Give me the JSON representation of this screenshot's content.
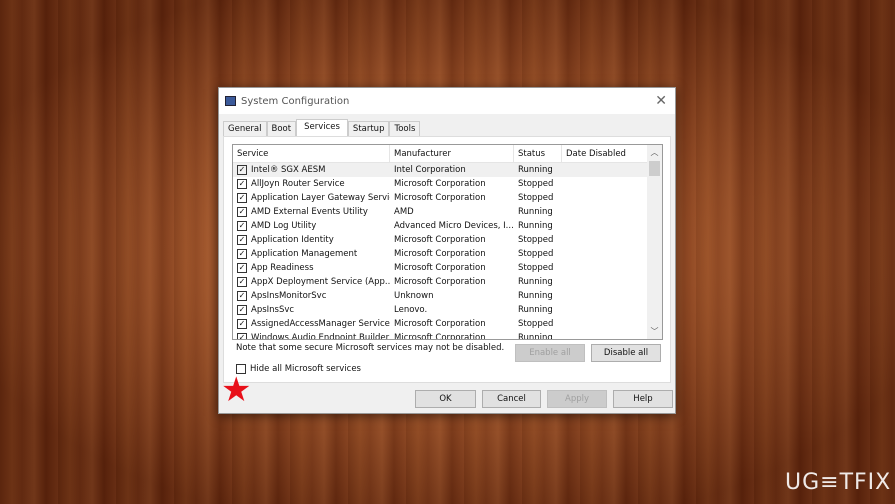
{
  "window": {
    "title": "System Configuration",
    "close": "✕"
  },
  "tabs": [
    "General",
    "Boot",
    "Services",
    "Startup",
    "Tools"
  ],
  "columns": [
    "Service",
    "Manufacturer",
    "Status",
    "Date Disabled"
  ],
  "rows": [
    [
      "Intel® SGX AESM",
      "Intel Corporation",
      "Running",
      ""
    ],
    [
      "AllJoyn Router Service",
      "Microsoft Corporation",
      "Stopped",
      ""
    ],
    [
      "Application Layer Gateway Service",
      "Microsoft Corporation",
      "Stopped",
      ""
    ],
    [
      "AMD External Events Utility",
      "AMD",
      "Running",
      ""
    ],
    [
      "AMD Log Utility",
      "Advanced Micro Devices, I...",
      "Running",
      ""
    ],
    [
      "Application Identity",
      "Microsoft Corporation",
      "Stopped",
      ""
    ],
    [
      "Application Management",
      "Microsoft Corporation",
      "Stopped",
      ""
    ],
    [
      "App Readiness",
      "Microsoft Corporation",
      "Stopped",
      ""
    ],
    [
      "AppX Deployment Service (App...",
      "Microsoft Corporation",
      "Running",
      ""
    ],
    [
      "ApsInsMonitorSvc",
      "Unknown",
      "Running",
      ""
    ],
    [
      "ApsInsSvc",
      "Lenovo.",
      "Running",
      ""
    ],
    [
      "AssignedAccessManager Service",
      "Microsoft Corporation",
      "Stopped",
      ""
    ],
    [
      "Windows Audio Endpoint Builder",
      "Microsoft Corporation",
      "Running",
      ""
    ]
  ],
  "note": "Note that some secure Microsoft services may not be disabled.",
  "buttons": {
    "enable_all": "Enable all",
    "disable_all": "Disable all",
    "ok": "OK",
    "cancel": "Cancel",
    "apply": "Apply",
    "help": "Help"
  },
  "hide_ms": {
    "label": "Hide all Microsoft services",
    "checked": false
  },
  "watermark": "UG≡TFIX"
}
